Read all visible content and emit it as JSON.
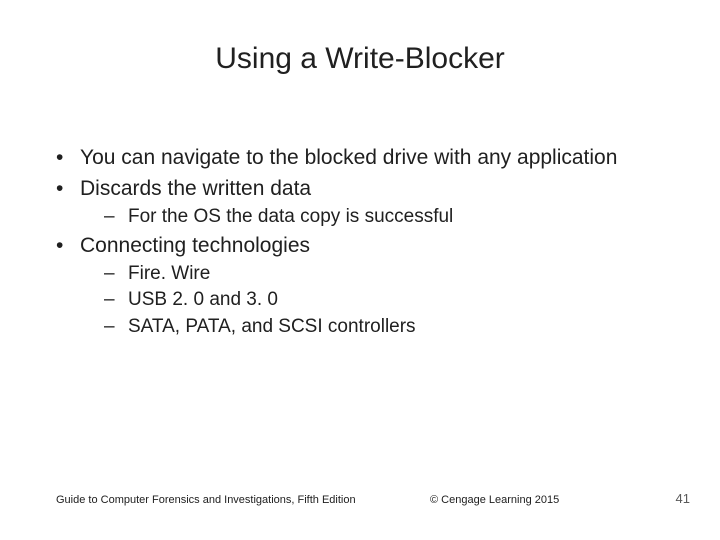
{
  "slide": {
    "title": "Using a Write-Blocker",
    "bullets": [
      {
        "text": "You can navigate to the blocked drive with any application",
        "children": []
      },
      {
        "text": "Discards the written data",
        "children": [
          "For the OS the data copy is successful"
        ]
      },
      {
        "text": "Connecting technologies",
        "children": [
          "Fire. Wire",
          "USB 2. 0 and 3. 0",
          "SATA, PATA, and SCSI controllers"
        ]
      }
    ],
    "footer": {
      "left": "Guide to Computer Forensics and Investigations, Fifth Edition",
      "center": "© Cengage Learning  2015",
      "page": "41"
    }
  }
}
